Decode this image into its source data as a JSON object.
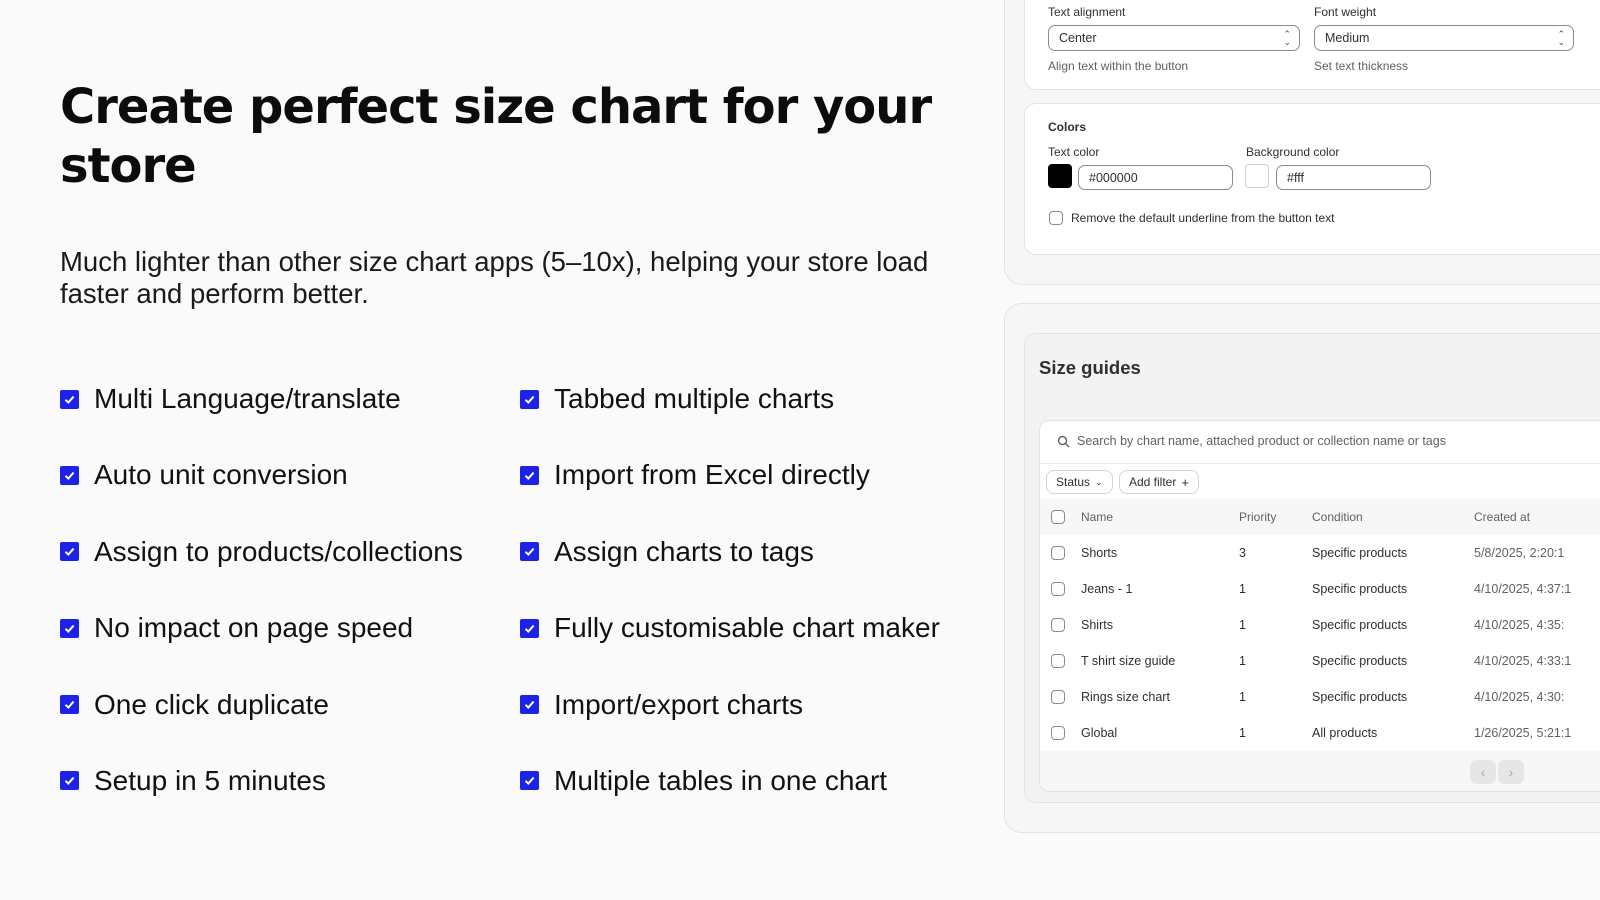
{
  "hero": {
    "title": "Create perfect size chart  for  your store",
    "subtitle": "Much lighter than other size chart apps (5–10x), helping your store load faster and perform better."
  },
  "features": {
    "left": [
      "Multi Language/translate",
      "Auto unit conversion",
      "Assign to products/collections",
      "No impact on page speed",
      "One click duplicate",
      "Setup in 5 minutes"
    ],
    "right": [
      "Tabbed multiple charts",
      "Import from Excel directly",
      "Assign charts to tags",
      "Fully customisable chart maker",
      "Import/export charts",
      "Multiple tables in one chart"
    ]
  },
  "settings": {
    "text_alignment": {
      "label": "Text alignment",
      "value": "Center",
      "hint": "Align text within the button"
    },
    "font_weight": {
      "label": "Font weight",
      "value": "Medium",
      "hint": "Set text thickness"
    },
    "colors": {
      "heading": "Colors",
      "text_color": {
        "label": "Text color",
        "value": "#000000",
        "swatch": "#000000"
      },
      "background_color": {
        "label": "Background color",
        "value": "#fff",
        "swatch": "#ffffff"
      },
      "underline_option": "Remove the default underline from the button text"
    }
  },
  "size_guides": {
    "title": "Size guides",
    "search_placeholder": "Search by chart name, attached product or collection name or tags",
    "filters": {
      "status": "Status",
      "add_filter": "Add filter"
    },
    "columns": {
      "name": "Name",
      "priority": "Priority",
      "condition": "Condition",
      "created_at": "Created at"
    },
    "rows": [
      {
        "name": "Shorts",
        "priority": "3",
        "condition": "Specific products",
        "created_at": "5/8/2025, 2:20:1"
      },
      {
        "name": "Jeans - 1",
        "priority": "1",
        "condition": "Specific products",
        "created_at": "4/10/2025, 4:37:1"
      },
      {
        "name": "Shirts",
        "priority": "1",
        "condition": "Specific products",
        "created_at": "4/10/2025, 4:35:"
      },
      {
        "name": "T shirt size guide",
        "priority": "1",
        "condition": "Specific products",
        "created_at": "4/10/2025, 4:33:1"
      },
      {
        "name": "Rings size chart",
        "priority": "1",
        "condition": "Specific products",
        "created_at": "4/10/2025, 4:30:"
      },
      {
        "name": "Global",
        "priority": "1",
        "condition": "All products",
        "created_at": "1/26/2025, 5:21:1"
      }
    ]
  },
  "colors": {
    "accent": "#1d23e6"
  }
}
